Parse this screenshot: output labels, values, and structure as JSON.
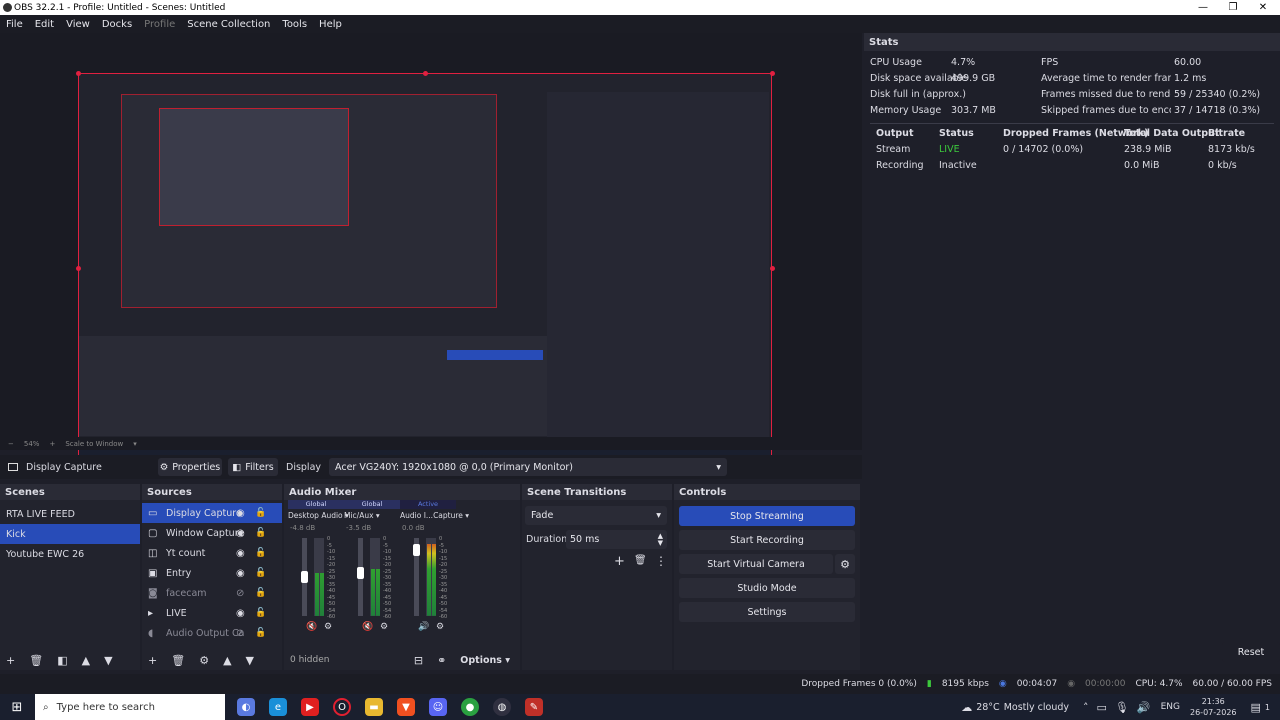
{
  "window": {
    "title": "OBS 32.2.1 - Profile: Untitled - Scenes: Untitled",
    "minimize": "—",
    "restore": "❐",
    "close": "✕"
  },
  "menu": [
    "File",
    "Edit",
    "View",
    "Docks",
    "Profile",
    "Scene Collection",
    "Tools",
    "Help"
  ],
  "zoom": {
    "percent": "54%",
    "mode": "Scale to Window"
  },
  "context": {
    "source": "Display Capture",
    "properties": "Properties",
    "filters": "Filters",
    "display_label": "Display",
    "display_value": "Acer VG240Y: 1920x1080 @ 0,0 (Primary Monitor)"
  },
  "scenes": {
    "title": "Scenes",
    "items": [
      "RTA LIVE FEED",
      "Kick",
      "Youtube EWC 26"
    ],
    "selected": 1
  },
  "sources": {
    "title": "Sources",
    "items": [
      {
        "label": "Display Capture",
        "icon": "monitor-icon",
        "visible": true
      },
      {
        "label": "Window Capture",
        "icon": "window-icon",
        "visible": true
      },
      {
        "label": "Yt count",
        "icon": "text-icon",
        "visible": true
      },
      {
        "label": "Entry",
        "icon": "media-icon",
        "visible": true
      },
      {
        "label": "facecam",
        "icon": "camera-icon",
        "visible": false
      },
      {
        "label": "LIVE",
        "icon": "folder-icon",
        "visible": true
      },
      {
        "label": "Audio Output Ca",
        "icon": "speaker-icon",
        "visible": false
      }
    ]
  },
  "mixer": {
    "title": "Audio Mixer",
    "hidden_label": "0 hidden",
    "options": "Options",
    "channels": [
      {
        "tag": "Global",
        "name": "Desktop Audio",
        "db": "-4.8 dB",
        "level": 0.55,
        "fader": 0.5
      },
      {
        "tag": "Global",
        "name": "Mic/Aux",
        "db": "-3.5 dB",
        "level": 0.6,
        "fader": 0.55
      },
      {
        "tag": "Active",
        "name": "Audio I...Capture",
        "db": "0.0 dB",
        "level": 0.92,
        "fader": 0.85
      }
    ],
    "scale": [
      "0",
      "-5",
      "-10",
      "-15",
      "-20",
      "-25",
      "-30",
      "-35",
      "-40",
      "-45",
      "-50",
      "-54",
      "-60"
    ]
  },
  "transitions": {
    "title": "Scene Transitions",
    "type": "Fade",
    "duration_label": "Duration",
    "duration": "50 ms"
  },
  "controls": {
    "title": "Controls",
    "stop_streaming": "Stop Streaming",
    "start_recording": "Start Recording",
    "start_virtual_camera": "Start Virtual Camera",
    "studio_mode": "Studio Mode",
    "settings": "Settings"
  },
  "stats": {
    "title": "Stats",
    "left": [
      [
        "CPU Usage",
        "4.7%"
      ],
      [
        "Disk space available",
        "499.9 GB"
      ],
      [
        "Disk full in (approx.)",
        ""
      ],
      [
        "Memory Usage",
        "303.7 MB"
      ]
    ],
    "right": [
      [
        "FPS",
        "60.00"
      ],
      [
        "Average time to render frame",
        "1.2 ms"
      ],
      [
        "Frames missed due to rendering lag",
        "59 / 25340 (0.2%)"
      ],
      [
        "Skipped frames due to encoding lag",
        "37 / 14718 (0.3%)"
      ]
    ],
    "columns": [
      "Output",
      "Status",
      "Dropped Frames (Network)",
      "Total Data Output",
      "Bitrate"
    ],
    "rows": [
      [
        "Stream",
        "LIVE",
        "0 / 14702 (0.0%)",
        "238.9 MiB",
        "8173 kb/s"
      ],
      [
        "Recording",
        "Inactive",
        "",
        "0.0 MiB",
        "0 kb/s"
      ]
    ],
    "reset": "Reset"
  },
  "status": {
    "dropped": "Dropped Frames 0 (0.0%)",
    "kbps": "8195 kbps",
    "live_time": "00:04:07",
    "rec_time": "00:00:00",
    "cpu": "CPU: 4.7%",
    "fps": "60.00 / 60.00 FPS"
  },
  "taskbar": {
    "search": "Type here to search",
    "weather_temp": "28°C",
    "weather_text": "Mostly cloudy",
    "lang": "ENG",
    "time": "21:36",
    "date": "26-07-2026",
    "notif": "1"
  },
  "colors": {
    "accent": "#284cb8",
    "live": "#3cc83c",
    "recording": "#e02040"
  }
}
